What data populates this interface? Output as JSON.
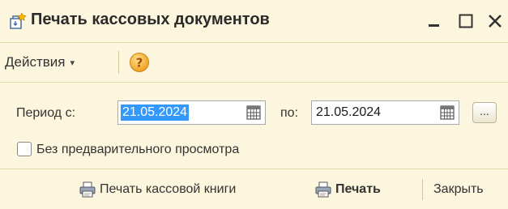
{
  "window": {
    "title": "Печать кассовых документов",
    "min_symbol": "_",
    "max_symbol": "☐",
    "close_symbol": "✕"
  },
  "toolbar": {
    "actions_label": "Действия",
    "actions_caret": "▾"
  },
  "form": {
    "period_label": "Период с:",
    "date_from": "21.05.2024",
    "to_label": "по:",
    "date_to": "21.05.2024",
    "more_label": "...",
    "no_preview_label": "Без предварительного просмотра",
    "no_preview_checked": false
  },
  "bottom": {
    "print_book_label": "Печать кассовой книги",
    "print_label": "Печать",
    "close_label": "Закрыть"
  },
  "colors": {
    "background": "#fbf6dd",
    "selection": "#3399ff",
    "help_icon": "#f0a020"
  }
}
